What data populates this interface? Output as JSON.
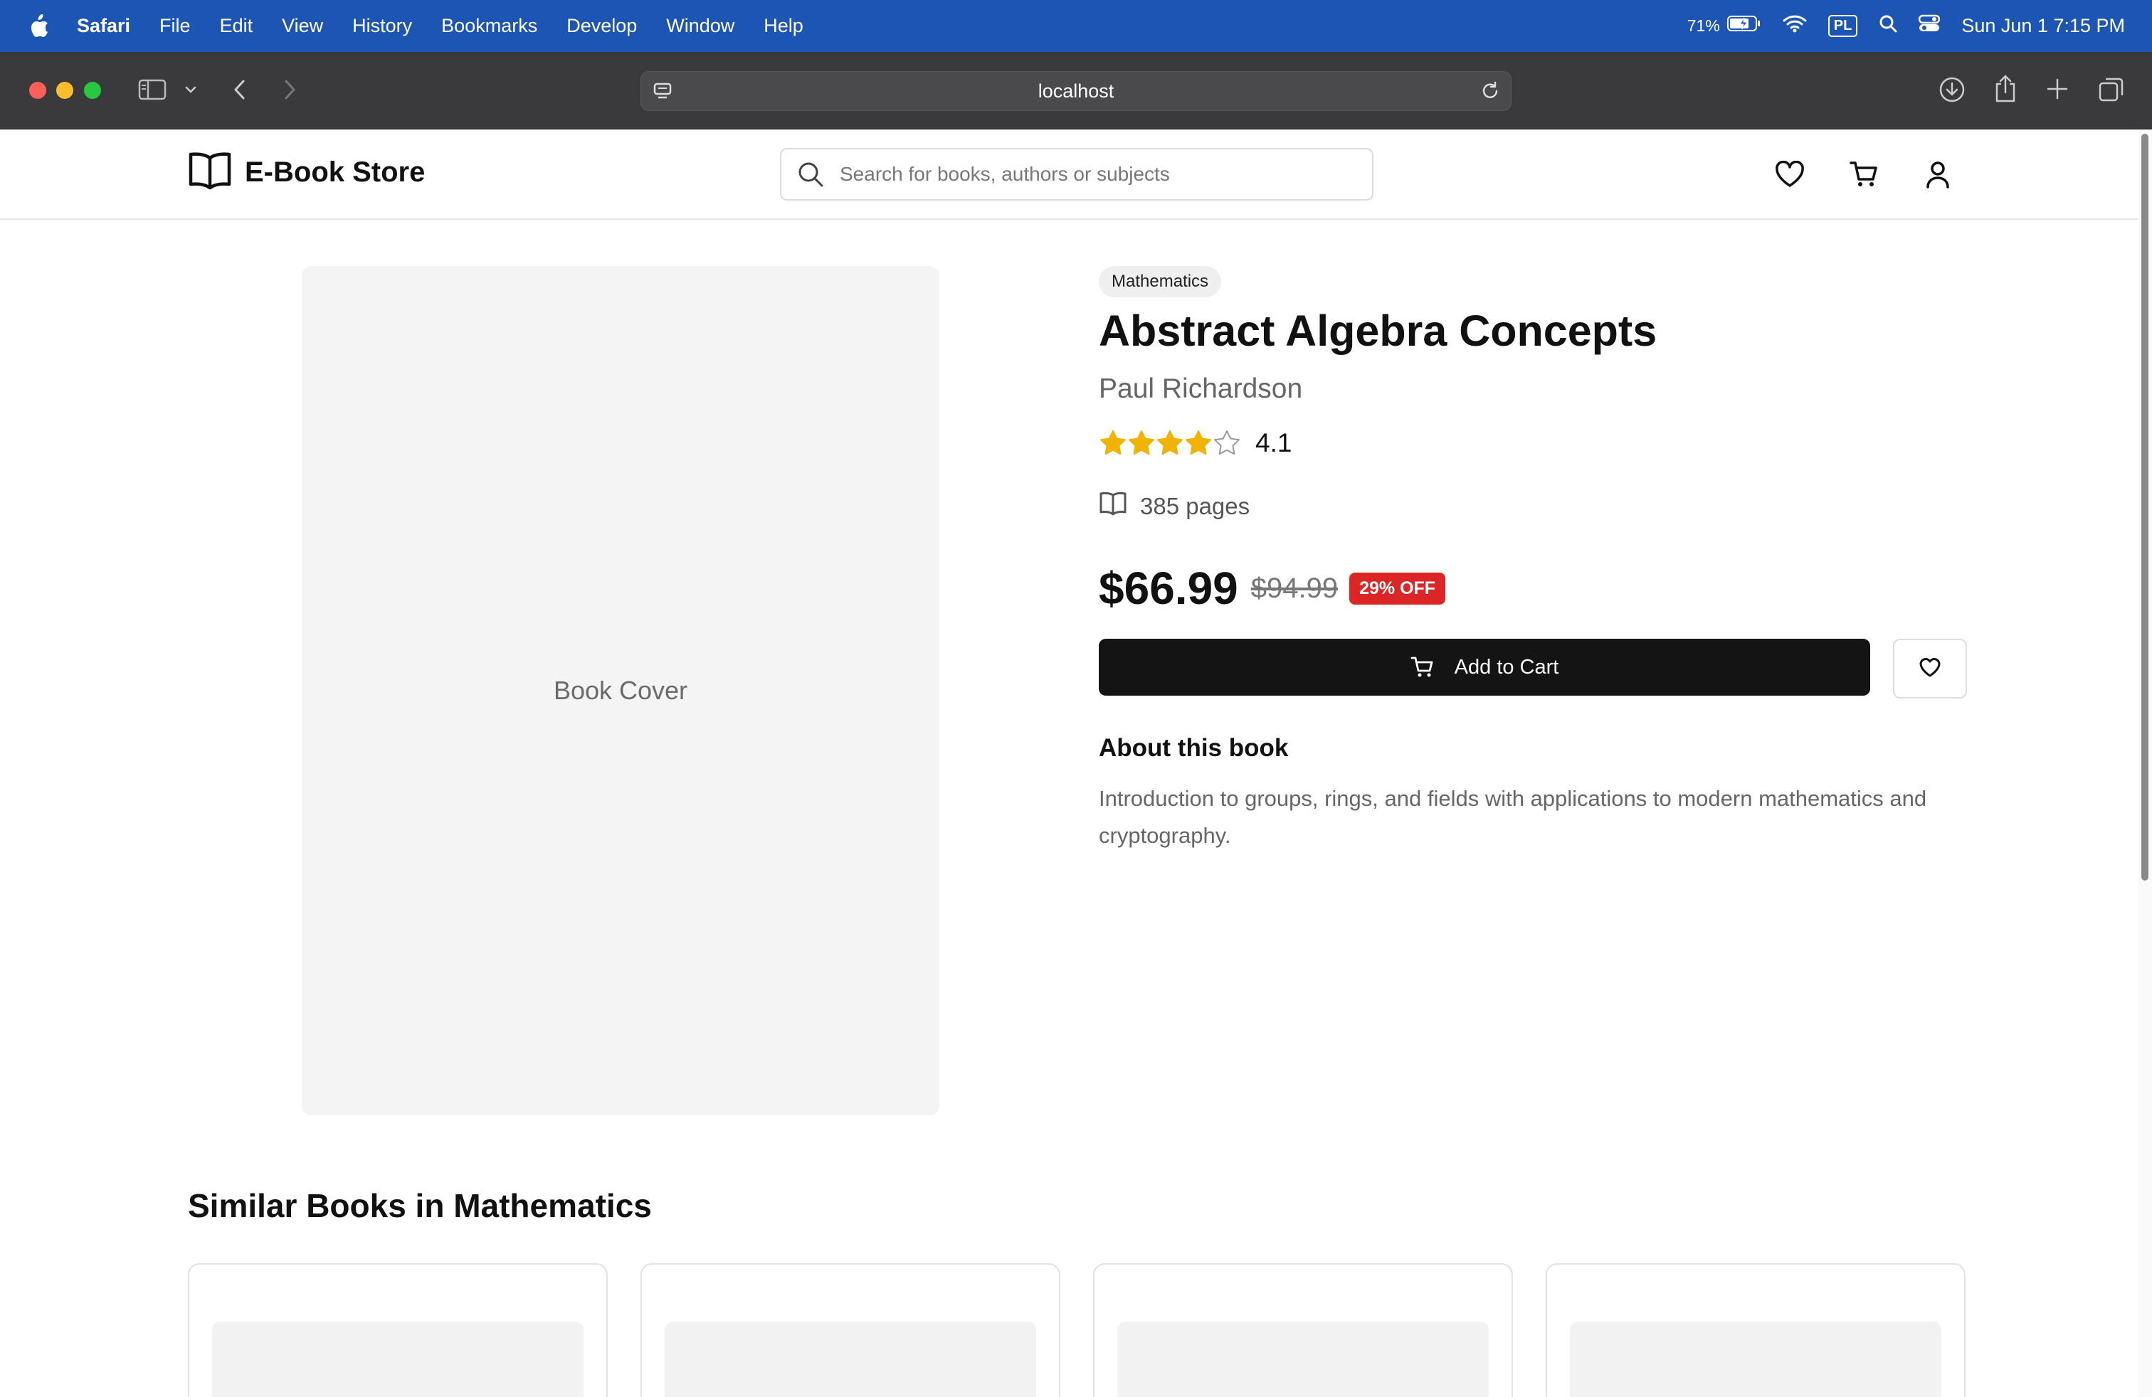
{
  "menubar": {
    "app": "Safari",
    "items": [
      "File",
      "Edit",
      "View",
      "History",
      "Bookmarks",
      "Develop",
      "Window",
      "Help"
    ],
    "battery": "71%",
    "input_source": "PL",
    "clock": "Sun Jun 1  7:15 PM"
  },
  "browser": {
    "url": "localhost"
  },
  "site": {
    "name": "E-Book Store",
    "search_placeholder": "Search for books, authors or subjects"
  },
  "book": {
    "category": "Mathematics",
    "title": "Abstract Algebra Concepts",
    "author": "Paul Richardson",
    "rating": "4.1",
    "rating_value": 4.1,
    "rating_max": 5,
    "pages": "385 pages",
    "price": "$66.99",
    "original_price": "$94.99",
    "discount": "29% OFF",
    "cover_label": "Book Cover",
    "add_to_cart": "Add to Cart",
    "about_heading": "About this book",
    "description": "Introduction to groups, rings, and fields with applications to modern mathematics and cryptography."
  },
  "similar": {
    "heading": "Similar Books in Mathematics",
    "card_count": 4
  },
  "colors": {
    "menubar": "#1d55b4",
    "star": "#f0b400",
    "discount": "#dc2626",
    "primary_button": "#141414"
  }
}
